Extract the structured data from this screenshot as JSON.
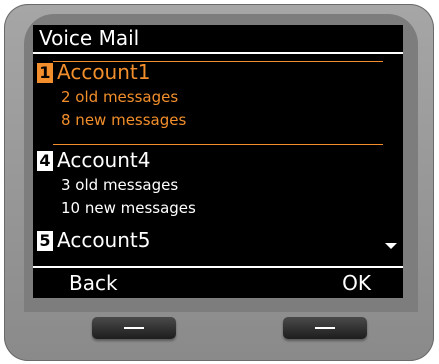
{
  "screen": {
    "title": "Voice Mail",
    "accounts": [
      {
        "number": "1",
        "name": "Account1",
        "old": "2 old messages",
        "new": "8 new messages",
        "selected": true
      },
      {
        "number": "4",
        "name": "Account4",
        "old": "3 old messages",
        "new": "10 new messages",
        "selected": false
      },
      {
        "number": "5",
        "name": "Account5",
        "selected": false
      }
    ],
    "softkeys": {
      "left": "Back",
      "right": "OK"
    }
  },
  "colors": {
    "highlight": "#f28e2b",
    "screen": "#000000",
    "text": "#ffffff"
  },
  "icons": {
    "scroll": "scroll-down-icon"
  }
}
